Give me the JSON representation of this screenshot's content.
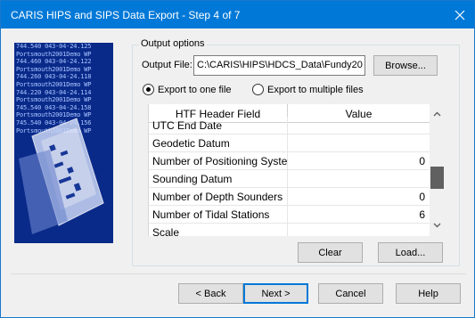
{
  "window": {
    "title": "CARIS HIPS and SIPS Data Export - Step 4 of 7"
  },
  "banner": {
    "lines": [
      "744.540 043-04-24.125",
      "Portsmouth2001Demo WP",
      "744.460 043-04-24.122",
      "Portsmouth2001Demo WP",
      "744.260 043-04-24.118",
      "Portsmouth2001Demo WP",
      "744.220 043-04-24.114",
      "Portsmouth2001Demo WP",
      "745.540 043-04-24.158",
      "Portsmouth2001Demo WP",
      "745.540 043-04-24.156",
      "Portsmouth2001Demo WP"
    ]
  },
  "output": {
    "group_label": "Output options",
    "file_label": "Output File:",
    "file_value": "C:\\CARIS\\HIPS\\HDCS_Data\\Fundy20",
    "browse_label": "Browse...",
    "radio_one": "Export to one file",
    "radio_multiple": "Export to multiple files"
  },
  "grid": {
    "columns": [
      "HTF Header Field",
      "Value"
    ],
    "rows": [
      {
        "field": "UTC End Date",
        "value": ""
      },
      {
        "field": "Geodetic Datum",
        "value": ""
      },
      {
        "field": "Number of Positioning Syste",
        "value": "0"
      },
      {
        "field": "Sounding Datum",
        "value": ""
      },
      {
        "field": "Number of Depth Sounders",
        "value": "0"
      },
      {
        "field": "Number of Tidal Stations",
        "value": "6"
      },
      {
        "field": "Scale",
        "value": ""
      }
    ]
  },
  "actions": {
    "clear_label": "Clear",
    "load_label": "Load..."
  },
  "footer": {
    "back": "< Back",
    "next": "Next >",
    "cancel": "Cancel",
    "help": "Help"
  },
  "colors": {
    "titlebar": "#0078d7",
    "banner": "#0a2a8a",
    "scroll_thumb": "#606060"
  }
}
